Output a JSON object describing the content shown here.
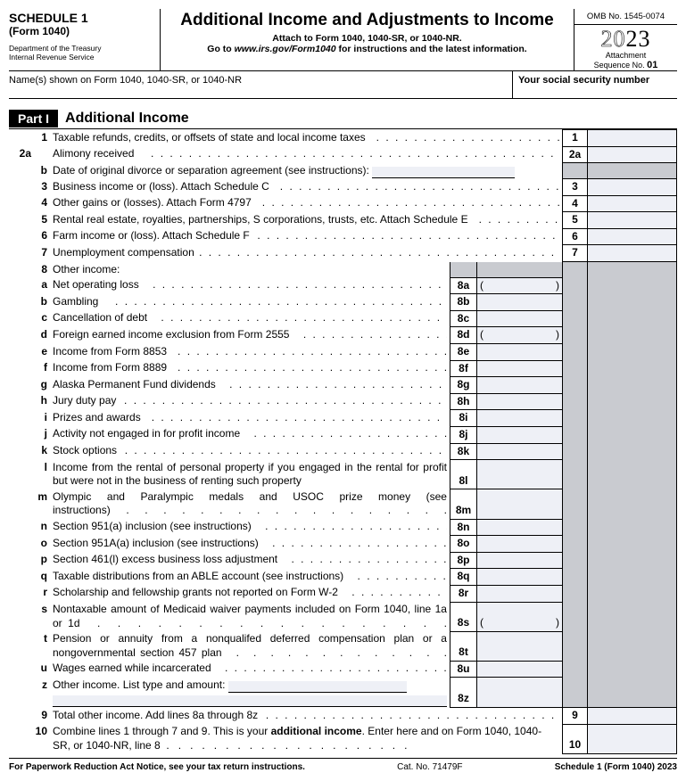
{
  "header": {
    "schedule": "SCHEDULE 1",
    "form": "(Form 1040)",
    "dept": "Department of the Treasury",
    "irs": "Internal Revenue Service",
    "title": "Additional Income and Adjustments to Income",
    "attach": "Attach to Form 1040, 1040-SR, or 1040-NR.",
    "goto_pre": "Go to ",
    "goto_link": "www.irs.gov/Form1040",
    "goto_post": " for instructions and the latest information.",
    "omb": "OMB No. 1545-0074",
    "year_open": "20",
    "year_solid": "23",
    "att_label": "Attachment",
    "seq_label": "Sequence No. ",
    "seq_no": "01"
  },
  "row2": {
    "names": "Name(s) shown on Form 1040, 1040-SR, or 1040-NR",
    "ssn": "Your social security number"
  },
  "part": {
    "tag": "Part I",
    "title": "Additional Income"
  },
  "lines": {
    "l1": "Taxable refunds, credits, or offsets of state and local income taxes",
    "l2a": "Alimony received",
    "l2b": "Date of original divorce or separation agreement (see instructions):",
    "l3": "Business income or (loss). Attach Schedule C",
    "l4": "Other gains or (losses). Attach Form 4797",
    "l5": "Rental real estate, royalties, partnerships, S corporations, trusts, etc. Attach Schedule E",
    "l6": "Farm income or (loss). Attach Schedule F",
    "l7": "Unemployment compensation",
    "l8": "Other income:",
    "l8a": "Net operating loss",
    "l8b": "Gambling",
    "l8c": "Cancellation of debt",
    "l8d": "Foreign earned income exclusion from Form 2555",
    "l8e": "Income from Form 8853",
    "l8f": "Income from Form 8889",
    "l8g": "Alaska Permanent Fund dividends",
    "l8h": "Jury duty pay",
    "l8i": "Prizes and awards",
    "l8j": "Activity not engaged in for profit income",
    "l8k": "Stock options",
    "l8l": "Income from the rental of personal property if you engaged in the rental for profit but were not in the business of renting such property",
    "l8m": "Olympic and Paralympic medals and USOC prize money (see instructions)",
    "l8n": "Section 951(a) inclusion (see instructions)",
    "l8o": "Section 951A(a) inclusion (see instructions)",
    "l8p": "Section 461(l) excess business loss adjustment",
    "l8q": "Taxable distributions from an ABLE account (see instructions)",
    "l8r": "Scholarship and fellowship grants not reported on Form W-2",
    "l8s": "Nontaxable amount of Medicaid waiver payments included on Form 1040, line 1a or 1d",
    "l8t": "Pension or annuity from a nonqualifed deferred compensation plan or a nongovernmental section 457 plan",
    "l8u": "Wages earned while incarcerated",
    "l8z": "Other income. List type and amount:",
    "l9": "Total other income. Add lines 8a through 8z",
    "l10a": "Combine lines 1 through 7 and 9. This is your ",
    "l10b": "additional income",
    "l10c": ". Enter here and on Form 1040, 1040-SR, or 1040-NR, line 8"
  },
  "box": {
    "b1": "1",
    "b2a": "2a",
    "b3": "3",
    "b4": "4",
    "b5": "5",
    "b6": "6",
    "b7": "7",
    "b8a": "8a",
    "b8b": "8b",
    "b8c": "8c",
    "b8d": "8d",
    "b8e": "8e",
    "b8f": "8f",
    "b8g": "8g",
    "b8h": "8h",
    "b8i": "8i",
    "b8j": "8j",
    "b8k": "8k",
    "b8l": "8l",
    "b8m": "8m",
    "b8n": "8n",
    "b8o": "8o",
    "b8p": "8p",
    "b8q": "8q",
    "b8r": "8r",
    "b8s": "8s",
    "b8t": "8t",
    "b8u": "8u",
    "b8z": "8z",
    "b9": "9",
    "b10": "10"
  },
  "footer": {
    "left": "For Paperwork Reduction Act Notice, see your tax return instructions.",
    "cat": "Cat. No. 71479F",
    "right": "Schedule 1 (Form 1040) 2023"
  }
}
